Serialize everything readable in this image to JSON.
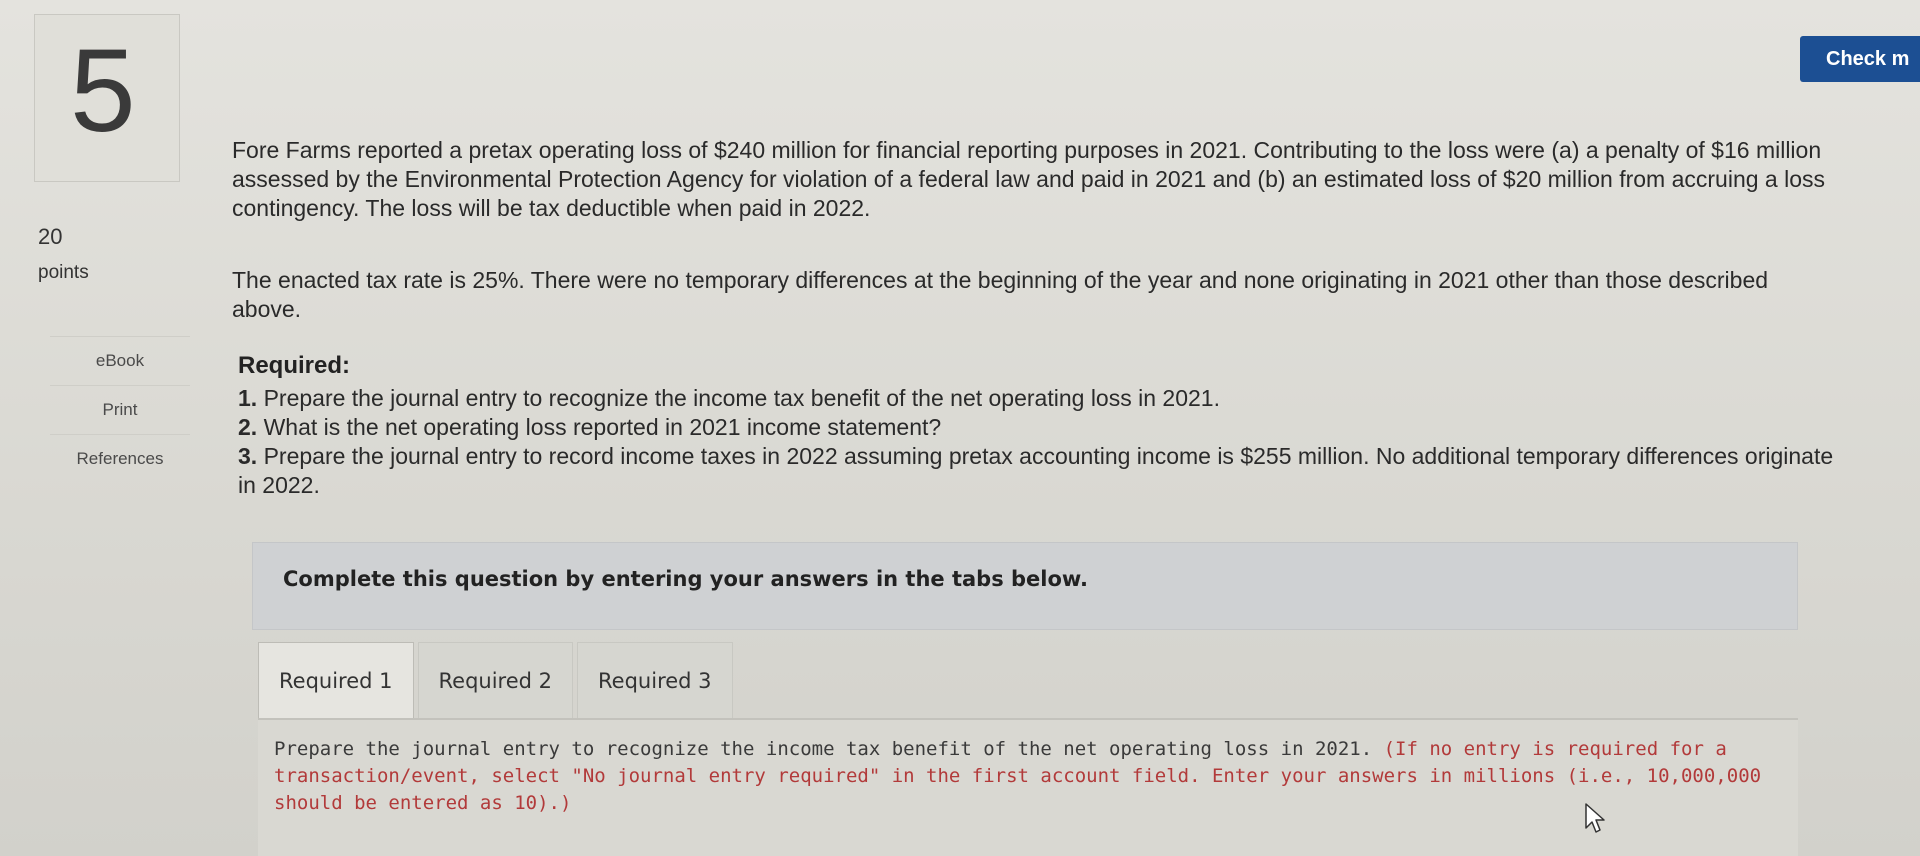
{
  "question": {
    "number": "5",
    "points_value": "20",
    "points_label": "points"
  },
  "sidebar": {
    "links": [
      {
        "label": "eBook"
      },
      {
        "label": "Print"
      },
      {
        "label": "References"
      }
    ]
  },
  "header": {
    "check_label": "Check m"
  },
  "problem": {
    "paragraph1": "Fore Farms reported a pretax operating loss of $240 million for financial reporting purposes in 2021. Contributing to the loss were (a) a penalty of $16 million assessed by the Environmental Protection Agency for violation of a federal law and paid in 2021 and (b) an estimated loss of $20 million from accruing a loss contingency. The loss will be tax deductible when paid in 2022.",
    "paragraph2": "The enacted tax rate is 25%. There were no temporary differences at the beginning of the year and none originating in 2021 other than those described above.",
    "required_title": "Required:",
    "required_items": [
      {
        "num": "1.",
        "text": "Prepare the journal entry to recognize the income tax benefit of the net operating loss in 2021."
      },
      {
        "num": "2.",
        "text": "What is the net operating loss reported in 2021 income statement?"
      },
      {
        "num": "3.",
        "text": "Prepare the journal entry to record income taxes in 2022 assuming pretax accounting income is $255 million. No additional temporary differences originate in 2022."
      }
    ]
  },
  "instructions": {
    "text": "Complete this question by entering your answers in the tabs below."
  },
  "tabs": [
    {
      "label": "Required 1",
      "active": true
    },
    {
      "label": "Required 2",
      "active": false
    },
    {
      "label": "Required 3",
      "active": false
    }
  ],
  "task": {
    "main": "Prepare the journal entry to recognize the income tax benefit of the net operating loss in 2021.",
    "note": "(If no entry is required for a transaction/event, select \"No journal entry required\" in the first account field. Enter your answers in millions (i.e., 10,000,000 should be entered as 10).)"
  },
  "colors": {
    "accent": "#1c4f93",
    "note": "#b23a3a"
  }
}
